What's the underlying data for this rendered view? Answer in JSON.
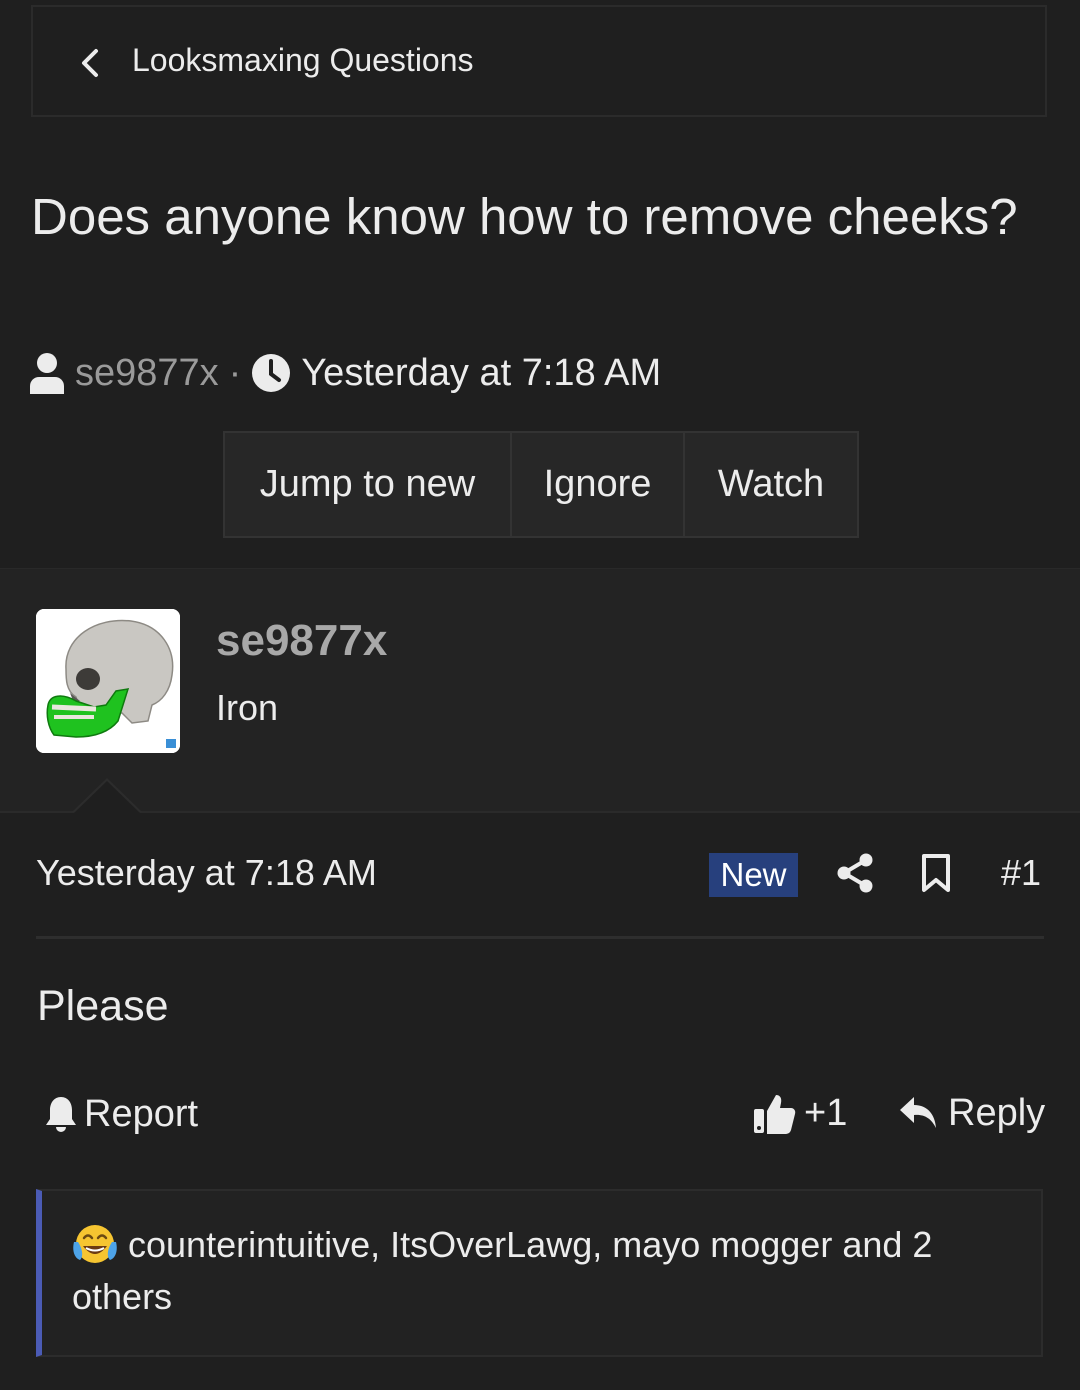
{
  "breadcrumb": {
    "label": "Looksmaxing Questions"
  },
  "thread": {
    "title": "Does anyone know how to remove cheeks?",
    "author": "se9877x",
    "separator": "·",
    "time": "Yesterday at 7:18 AM"
  },
  "actions": {
    "jump_label": "Jump to new",
    "ignore_label": "Ignore",
    "watch_label": "Watch"
  },
  "user": {
    "name": "se9877x",
    "title": "Iron"
  },
  "post": {
    "date": "Yesterday at 7:18 AM",
    "badge": "New",
    "number": "#1",
    "body": "Please",
    "report_label": "Report",
    "like_label": "+1",
    "reply_label": "Reply",
    "reactions_text": "counterintuitive, ItsOverLawg, mayo mogger and 2 others"
  },
  "colors": {
    "background": "#1f1f1f",
    "badge_bg": "#27407d",
    "reaction_accent": "#4b5bb5"
  },
  "icons": [
    "chevron-left-icon",
    "user-icon",
    "clock-icon",
    "share-icon",
    "bookmark-icon",
    "bell-icon",
    "thumbs-up-icon",
    "reply-icon",
    "laughing-crying-emoji"
  ]
}
